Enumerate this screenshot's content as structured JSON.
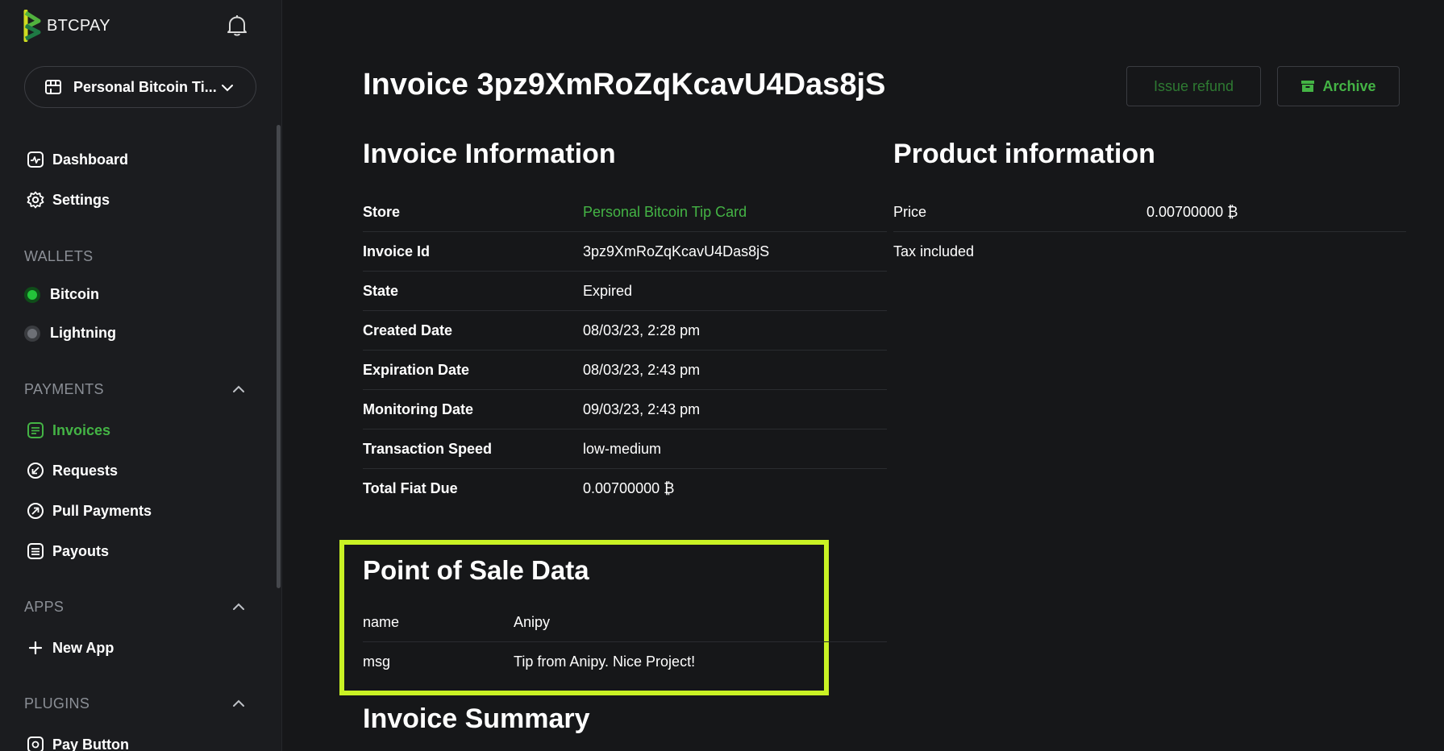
{
  "brand": {
    "name": "BTCPAY"
  },
  "store_selector": {
    "label": "Personal Bitcoin Ti..."
  },
  "nav": {
    "dashboard": "Dashboard",
    "settings": "Settings"
  },
  "wallets": {
    "title": "WALLETS",
    "bitcoin": "Bitcoin",
    "lightning": "Lightning",
    "bitcoin_status_color": "#23c43a",
    "lightning_status_color": "#6d7076"
  },
  "payments": {
    "title": "PAYMENTS",
    "invoices": "Invoices",
    "requests": "Requests",
    "pull_payments": "Pull Payments",
    "payouts": "Payouts"
  },
  "apps": {
    "title": "APPS",
    "new_app": "New App"
  },
  "plugins": {
    "title": "PLUGINS",
    "pay_button": "Pay Button"
  },
  "colors": {
    "accent": "#44b445",
    "highlight": "#c9f224",
    "background": "#161719",
    "sidebar": "#1b1c1f"
  },
  "icons": [
    "bell-icon",
    "store-icon",
    "chevron-down-icon",
    "dashboard-icon",
    "gear-icon",
    "invoice-icon",
    "requests-icon",
    "pull-payments-icon",
    "payouts-icon",
    "plus-icon",
    "pay-button-icon",
    "chevron-up-icon",
    "archive-icon"
  ],
  "header": {
    "title": "Invoice 3pz9XmRoZqKcavU4Das8jS",
    "issue_refund": "Issue refund",
    "archive": "Archive"
  },
  "invoice_info": {
    "title": "Invoice Information",
    "rows": [
      {
        "label": "Store",
        "value": "Personal Bitcoin Tip Card"
      },
      {
        "label": "Invoice Id",
        "value": "3pz9XmRoZqKcavU4Das8jS"
      },
      {
        "label": "State",
        "value": "Expired"
      },
      {
        "label": "Created Date",
        "value": "08/03/23, 2:28 pm"
      },
      {
        "label": "Expiration Date",
        "value": "08/03/23, 2:43 pm"
      },
      {
        "label": "Monitoring Date",
        "value": "09/03/23, 2:43 pm"
      },
      {
        "label": "Transaction Speed",
        "value": "low-medium"
      },
      {
        "label": "Total Fiat Due",
        "value": "0.00700000 ₿"
      }
    ]
  },
  "product_info": {
    "title": "Product information",
    "rows": [
      {
        "label": "Price",
        "value": "0.00700000 ₿"
      },
      {
        "label": "Tax included",
        "value": ""
      }
    ]
  },
  "pos_data": {
    "title": "Point of Sale Data",
    "rows": [
      {
        "label": "name",
        "value": "Anipy"
      },
      {
        "label": "msg",
        "value": "Tip from Anipy. Nice Project!"
      }
    ]
  },
  "invoice_summary": {
    "title": "Invoice Summary"
  }
}
